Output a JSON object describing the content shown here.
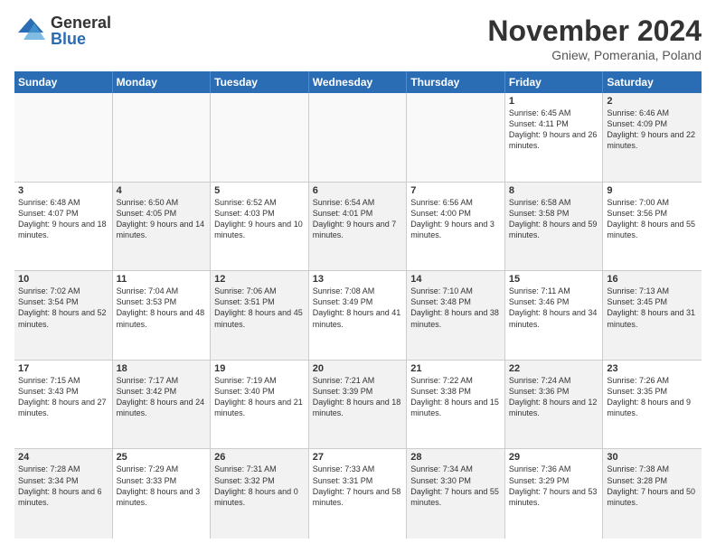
{
  "logo": {
    "general": "General",
    "blue": "Blue"
  },
  "title": "November 2024",
  "subtitle": "Gniew, Pomerania, Poland",
  "header_days": [
    "Sunday",
    "Monday",
    "Tuesday",
    "Wednesday",
    "Thursday",
    "Friday",
    "Saturday"
  ],
  "weeks": [
    [
      {
        "day": "",
        "info": "",
        "empty": true
      },
      {
        "day": "",
        "info": "",
        "empty": true
      },
      {
        "day": "",
        "info": "",
        "empty": true
      },
      {
        "day": "",
        "info": "",
        "empty": true
      },
      {
        "day": "",
        "info": "",
        "empty": true
      },
      {
        "day": "1",
        "info": "Sunrise: 6:45 AM\nSunset: 4:11 PM\nDaylight: 9 hours and 26 minutes.",
        "shade": false
      },
      {
        "day": "2",
        "info": "Sunrise: 6:46 AM\nSunset: 4:09 PM\nDaylight: 9 hours and 22 minutes.",
        "shade": true
      }
    ],
    [
      {
        "day": "3",
        "info": "Sunrise: 6:48 AM\nSunset: 4:07 PM\nDaylight: 9 hours and 18 minutes.",
        "shade": false
      },
      {
        "day": "4",
        "info": "Sunrise: 6:50 AM\nSunset: 4:05 PM\nDaylight: 9 hours and 14 minutes.",
        "shade": true
      },
      {
        "day": "5",
        "info": "Sunrise: 6:52 AM\nSunset: 4:03 PM\nDaylight: 9 hours and 10 minutes.",
        "shade": false
      },
      {
        "day": "6",
        "info": "Sunrise: 6:54 AM\nSunset: 4:01 PM\nDaylight: 9 hours and 7 minutes.",
        "shade": true
      },
      {
        "day": "7",
        "info": "Sunrise: 6:56 AM\nSunset: 4:00 PM\nDaylight: 9 hours and 3 minutes.",
        "shade": false
      },
      {
        "day": "8",
        "info": "Sunrise: 6:58 AM\nSunset: 3:58 PM\nDaylight: 8 hours and 59 minutes.",
        "shade": true
      },
      {
        "day": "9",
        "info": "Sunrise: 7:00 AM\nSunset: 3:56 PM\nDaylight: 8 hours and 55 minutes.",
        "shade": false
      }
    ],
    [
      {
        "day": "10",
        "info": "Sunrise: 7:02 AM\nSunset: 3:54 PM\nDaylight: 8 hours and 52 minutes.",
        "shade": true
      },
      {
        "day": "11",
        "info": "Sunrise: 7:04 AM\nSunset: 3:53 PM\nDaylight: 8 hours and 48 minutes.",
        "shade": false
      },
      {
        "day": "12",
        "info": "Sunrise: 7:06 AM\nSunset: 3:51 PM\nDaylight: 8 hours and 45 minutes.",
        "shade": true
      },
      {
        "day": "13",
        "info": "Sunrise: 7:08 AM\nSunset: 3:49 PM\nDaylight: 8 hours and 41 minutes.",
        "shade": false
      },
      {
        "day": "14",
        "info": "Sunrise: 7:10 AM\nSunset: 3:48 PM\nDaylight: 8 hours and 38 minutes.",
        "shade": true
      },
      {
        "day": "15",
        "info": "Sunrise: 7:11 AM\nSunset: 3:46 PM\nDaylight: 8 hours and 34 minutes.",
        "shade": false
      },
      {
        "day": "16",
        "info": "Sunrise: 7:13 AM\nSunset: 3:45 PM\nDaylight: 8 hours and 31 minutes.",
        "shade": true
      }
    ],
    [
      {
        "day": "17",
        "info": "Sunrise: 7:15 AM\nSunset: 3:43 PM\nDaylight: 8 hours and 27 minutes.",
        "shade": false
      },
      {
        "day": "18",
        "info": "Sunrise: 7:17 AM\nSunset: 3:42 PM\nDaylight: 8 hours and 24 minutes.",
        "shade": true
      },
      {
        "day": "19",
        "info": "Sunrise: 7:19 AM\nSunset: 3:40 PM\nDaylight: 8 hours and 21 minutes.",
        "shade": false
      },
      {
        "day": "20",
        "info": "Sunrise: 7:21 AM\nSunset: 3:39 PM\nDaylight: 8 hours and 18 minutes.",
        "shade": true
      },
      {
        "day": "21",
        "info": "Sunrise: 7:22 AM\nSunset: 3:38 PM\nDaylight: 8 hours and 15 minutes.",
        "shade": false
      },
      {
        "day": "22",
        "info": "Sunrise: 7:24 AM\nSunset: 3:36 PM\nDaylight: 8 hours and 12 minutes.",
        "shade": true
      },
      {
        "day": "23",
        "info": "Sunrise: 7:26 AM\nSunset: 3:35 PM\nDaylight: 8 hours and 9 minutes.",
        "shade": false
      }
    ],
    [
      {
        "day": "24",
        "info": "Sunrise: 7:28 AM\nSunset: 3:34 PM\nDaylight: 8 hours and 6 minutes.",
        "shade": true
      },
      {
        "day": "25",
        "info": "Sunrise: 7:29 AM\nSunset: 3:33 PM\nDaylight: 8 hours and 3 minutes.",
        "shade": false
      },
      {
        "day": "26",
        "info": "Sunrise: 7:31 AM\nSunset: 3:32 PM\nDaylight: 8 hours and 0 minutes.",
        "shade": true
      },
      {
        "day": "27",
        "info": "Sunrise: 7:33 AM\nSunset: 3:31 PM\nDaylight: 7 hours and 58 minutes.",
        "shade": false
      },
      {
        "day": "28",
        "info": "Sunrise: 7:34 AM\nSunset: 3:30 PM\nDaylight: 7 hours and 55 minutes.",
        "shade": true
      },
      {
        "day": "29",
        "info": "Sunrise: 7:36 AM\nSunset: 3:29 PM\nDaylight: 7 hours and 53 minutes.",
        "shade": false
      },
      {
        "day": "30",
        "info": "Sunrise: 7:38 AM\nSunset: 3:28 PM\nDaylight: 7 hours and 50 minutes.",
        "shade": true
      }
    ]
  ]
}
